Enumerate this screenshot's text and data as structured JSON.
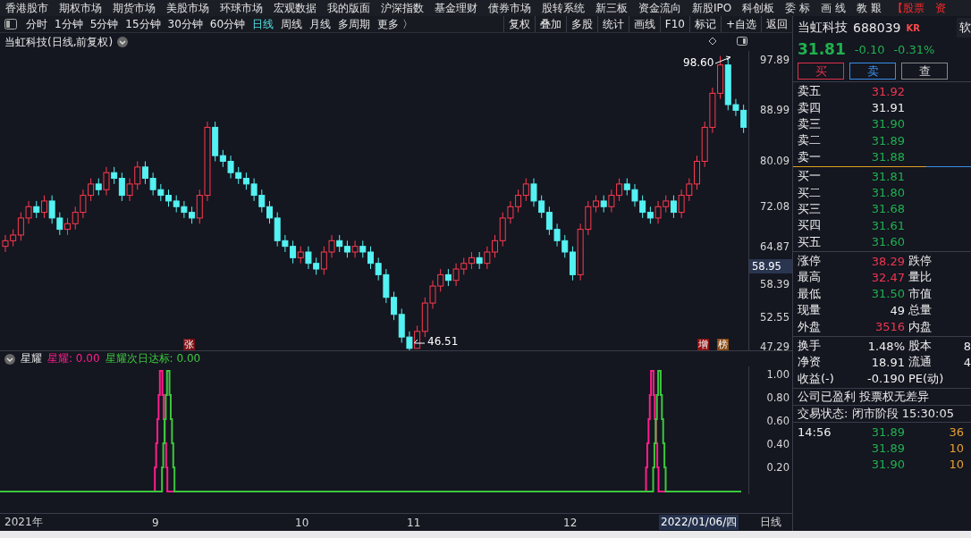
{
  "menu_bar": {
    "items": [
      {
        "label": "香港股市",
        "kind": "normal"
      },
      {
        "label": "期权市场",
        "kind": "normal"
      },
      {
        "label": "期货市场",
        "kind": "normal"
      },
      {
        "label": "美股市场",
        "kind": "normal"
      },
      {
        "label": "环球市场",
        "kind": "normal"
      },
      {
        "label": "宏观数据",
        "kind": "normal"
      },
      {
        "label": "我的版面",
        "kind": "normal"
      },
      {
        "label": "沪深指数",
        "kind": "normal"
      },
      {
        "label": "基金理财",
        "kind": "normal"
      },
      {
        "label": "债券市场",
        "kind": "normal"
      },
      {
        "label": "股转系统",
        "kind": "normal"
      },
      {
        "label": "新三板",
        "kind": "normal"
      },
      {
        "label": "资金流向",
        "kind": "normal"
      },
      {
        "label": "新股IPO",
        "kind": "normal"
      },
      {
        "label": "科创板",
        "kind": "normal"
      },
      {
        "label": "委 标",
        "kind": "normal"
      },
      {
        "label": "画 线",
        "kind": "normal"
      },
      {
        "label": "教 艱",
        "kind": "normal"
      },
      {
        "label": "【股票",
        "kind": "alert"
      },
      {
        "label": "资",
        "kind": "alert"
      }
    ]
  },
  "toolbar": {
    "periods": [
      {
        "label": "分时",
        "selected": false
      },
      {
        "label": "1分钟",
        "selected": false
      },
      {
        "label": "5分钟",
        "selected": false
      },
      {
        "label": "15分钟",
        "selected": false
      },
      {
        "label": "30分钟",
        "selected": false
      },
      {
        "label": "60分钟",
        "selected": false
      },
      {
        "label": "日线",
        "selected": true
      },
      {
        "label": "周线",
        "selected": false
      },
      {
        "label": "月线",
        "selected": false
      },
      {
        "label": "多周期",
        "selected": false
      },
      {
        "label": "更多 〉",
        "selected": false
      }
    ],
    "tools": [
      "复权",
      "叠加",
      "多股",
      "统计",
      "画线",
      "F10",
      "标记",
      "+自选",
      "返回"
    ]
  },
  "chart": {
    "title": "当虹科技(日线,前复权)",
    "current_price": "58.95",
    "high_marker": "98.60",
    "low_marker": "46.51",
    "badges": [
      {
        "label": "张",
        "color": "#7a0f12"
      },
      {
        "label": "增",
        "color": "#8c1010"
      },
      {
        "label": "榜",
        "color": "#8a4a12"
      }
    ],
    "chart_data": {
      "type": "candlestick",
      "ylim": [
        46.66,
        99.47
      ],
      "yticks": [
        97.89,
        88.99,
        80.09,
        72.08,
        64.87,
        58.39,
        52.55,
        47.29
      ],
      "categories": [
        null,
        null,
        null,
        null,
        null,
        null,
        null,
        null,
        null,
        null,
        null,
        null,
        null,
        null,
        null,
        null,
        null,
        null,
        null,
        null,
        null,
        null,
        null,
        null,
        null,
        null,
        null,
        null,
        null,
        null,
        null,
        null,
        null,
        null,
        null,
        null,
        null,
        null,
        null,
        null,
        null,
        null,
        null,
        null,
        null,
        null,
        null,
        null,
        null,
        null,
        null,
        null,
        null,
        null,
        null,
        null,
        null,
        null,
        null,
        null,
        null,
        null,
        null,
        null,
        null,
        null,
        null,
        null,
        null,
        null,
        null,
        null,
        null,
        null,
        null,
        null,
        null,
        null,
        null,
        null,
        null,
        null,
        null,
        null,
        null,
        null,
        null,
        null,
        null,
        null,
        null,
        null,
        null,
        null,
        null,
        null
      ],
      "ohlc": [
        [
          65,
          67,
          64,
          66
        ],
        [
          66,
          68,
          65,
          67
        ],
        [
          67,
          71,
          66,
          70
        ],
        [
          70,
          73,
          69,
          72
        ],
        [
          72,
          73,
          70,
          71
        ],
        [
          71,
          74,
          70,
          73
        ],
        [
          73,
          74,
          69,
          70
        ],
        [
          70,
          71,
          67,
          68
        ],
        [
          68,
          70,
          67,
          69
        ],
        [
          69,
          72,
          68,
          71
        ],
        [
          71,
          75,
          70,
          74
        ],
        [
          74,
          77,
          73,
          76
        ],
        [
          76,
          77,
          74,
          75
        ],
        [
          75,
          79,
          74,
          78
        ],
        [
          78,
          79,
          76,
          77
        ],
        [
          77,
          78,
          73,
          74
        ],
        [
          74,
          77,
          73,
          76
        ],
        [
          76,
          80,
          75,
          79
        ],
        [
          79,
          80,
          76,
          77
        ],
        [
          77,
          78,
          74,
          75
        ],
        [
          75,
          76,
          73,
          74
        ],
        [
          74,
          75,
          72,
          73
        ],
        [
          73,
          74,
          71,
          72
        ],
        [
          72,
          73,
          70,
          71
        ],
        [
          71,
          72,
          69,
          70
        ],
        [
          70,
          75,
          69,
          74
        ],
        [
          74,
          87,
          73,
          86
        ],
        [
          86,
          87,
          80,
          81
        ],
        [
          81,
          82,
          79,
          80
        ],
        [
          80,
          81,
          77,
          78
        ],
        [
          78,
          79,
          76,
          77
        ],
        [
          77,
          78,
          75,
          76
        ],
        [
          76,
          77,
          73,
          74
        ],
        [
          74,
          75,
          71,
          72
        ],
        [
          72,
          73,
          69,
          70
        ],
        [
          70,
          71,
          65,
          66
        ],
        [
          66,
          67,
          64,
          65
        ],
        [
          65,
          66,
          62,
          63
        ],
        [
          63,
          65,
          62,
          64
        ],
        [
          64,
          65,
          61,
          62
        ],
        [
          62,
          63,
          60,
          61
        ],
        [
          61,
          65,
          60,
          64
        ],
        [
          64,
          67,
          63,
          66
        ],
        [
          66,
          67,
          64,
          65
        ],
        [
          65,
          66,
          63,
          64
        ],
        [
          64,
          66,
          63,
          65
        ],
        [
          65,
          66,
          63,
          64
        ],
        [
          64,
          65,
          61,
          62
        ],
        [
          62,
          63,
          59,
          60
        ],
        [
          60,
          61,
          55,
          56
        ],
        [
          56,
          57,
          52,
          53
        ],
        [
          53,
          54,
          48,
          49
        ],
        [
          49,
          50,
          46.51,
          47
        ],
        [
          47,
          51,
          47,
          50
        ],
        [
          50,
          56,
          49,
          55
        ],
        [
          55,
          59,
          54,
          58
        ],
        [
          58,
          61,
          57,
          60
        ],
        [
          60,
          61,
          58,
          59
        ],
        [
          59,
          62,
          58,
          61
        ],
        [
          61,
          63,
          60,
          62
        ],
        [
          62,
          64,
          61,
          63
        ],
        [
          63,
          64,
          61,
          62
        ],
        [
          62,
          65,
          61,
          64
        ],
        [
          64,
          67,
          63,
          66
        ],
        [
          66,
          71,
          65,
          70
        ],
        [
          70,
          73,
          69,
          72
        ],
        [
          72,
          75,
          71,
          74
        ],
        [
          74,
          77,
          73,
          76
        ],
        [
          76,
          77,
          72,
          73
        ],
        [
          73,
          74,
          70,
          71
        ],
        [
          71,
          72,
          67,
          68
        ],
        [
          68,
          69,
          65,
          66
        ],
        [
          66,
          67,
          63,
          64
        ],
        [
          64,
          65,
          59,
          60
        ],
        [
          60,
          69,
          59,
          68
        ],
        [
          68,
          73,
          67,
          72
        ],
        [
          72,
          74,
          71,
          73
        ],
        [
          73,
          74,
          71,
          72
        ],
        [
          72,
          75,
          71,
          74
        ],
        [
          74,
          77,
          73,
          76
        ],
        [
          76,
          77,
          74,
          75
        ],
        [
          75,
          76,
          72,
          73
        ],
        [
          73,
          74,
          70,
          71
        ],
        [
          71,
          72,
          69,
          70
        ],
        [
          70,
          73,
          69,
          72
        ],
        [
          72,
          74,
          71,
          73
        ],
        [
          73,
          74,
          70,
          71
        ],
        [
          71,
          75,
          70,
          74
        ],
        [
          74,
          77,
          73,
          76
        ],
        [
          76,
          81,
          75,
          80
        ],
        [
          80,
          87,
          79,
          86
        ],
        [
          86,
          93,
          85,
          92
        ],
        [
          92,
          98.6,
          91,
          97
        ],
        [
          97,
          98,
          89,
          90
        ],
        [
          90,
          91,
          88,
          89
        ],
        [
          89,
          90,
          85,
          86
        ]
      ]
    }
  },
  "indicator": {
    "name": "星耀",
    "values": [
      {
        "label": "星耀: 0.00",
        "color": "#ff1e8c"
      },
      {
        "label": "星耀次日达标: 0.00",
        "color": "#3cc83c"
      }
    ],
    "axis": [
      "1.00",
      "0.80",
      "0.60",
      "0.40",
      "0.20"
    ]
  },
  "date_axis": {
    "labels": [
      "2021年",
      "9",
      "10",
      "11",
      "12"
    ],
    "cursor_date": "2022/01/06/四",
    "period": "日线"
  },
  "quote": {
    "name": "当虹科技",
    "code": "688039",
    "tag": "KR",
    "side_tab": "软",
    "price": "31.81",
    "change": "-0.10",
    "change_pct": "-0.31%",
    "buttons": [
      {
        "label": "买",
        "kind": "buy"
      },
      {
        "label": "卖",
        "kind": "sell"
      },
      {
        "label": "查",
        "kind": "query"
      }
    ]
  },
  "order_book": {
    "asks": [
      {
        "label": "卖五",
        "price": "31.92",
        "color": "#f0364f"
      },
      {
        "label": "卖四",
        "price": "31.91",
        "color": "#f0f0f0"
      },
      {
        "label": "卖三",
        "price": "31.90",
        "color": "#1fb14f"
      },
      {
        "label": "卖二",
        "price": "31.89",
        "color": "#1fb14f"
      },
      {
        "label": "卖一",
        "price": "31.88",
        "color": "#1fb14f"
      }
    ],
    "bids": [
      {
        "label": "买一",
        "price": "31.81",
        "color": "#1fb14f"
      },
      {
        "label": "买二",
        "price": "31.80",
        "color": "#1fb14f"
      },
      {
        "label": "买三",
        "price": "31.68",
        "color": "#1fb14f"
      },
      {
        "label": "买四",
        "price": "31.61",
        "color": "#1fb14f"
      },
      {
        "label": "买五",
        "price": "31.60",
        "color": "#1fb14f"
      }
    ]
  },
  "stats": [
    {
      "label": "涨停",
      "value": "38.29",
      "color": "#f0364f",
      "label_2": "跌停"
    },
    {
      "label": "最高",
      "value": "32.47",
      "color": "#f0364f",
      "label_2": "量比"
    },
    {
      "label": "最低",
      "value": "31.50",
      "color": "#1fb14f",
      "label_2": "市值"
    },
    {
      "label": "现量",
      "value": "49",
      "color": "#f0f0f0",
      "label_2": "总量"
    },
    {
      "label": "外盘",
      "value": "3516",
      "color": "#f0364f",
      "label_2": "内盘"
    }
  ],
  "finance": [
    {
      "label": "换手",
      "value": "1.48%",
      "label_2": "股本",
      "value_2": "8"
    },
    {
      "label": "净资",
      "value": "18.91",
      "label_2": "流通",
      "value_2": "4"
    },
    {
      "label": "收益(-)",
      "value": "-0.190",
      "label_2": "PE(动)"
    }
  ],
  "notes": [
    "公司已盈利 投票权无差异",
    "交易状态: 闭市阶段 15:30:05"
  ],
  "trades": [
    {
      "time": "14:56",
      "price": "31.89",
      "volume": "36"
    },
    {
      "price": "31.89",
      "volume": "10"
    },
    {
      "price": "31.90",
      "volume": "10"
    }
  ]
}
